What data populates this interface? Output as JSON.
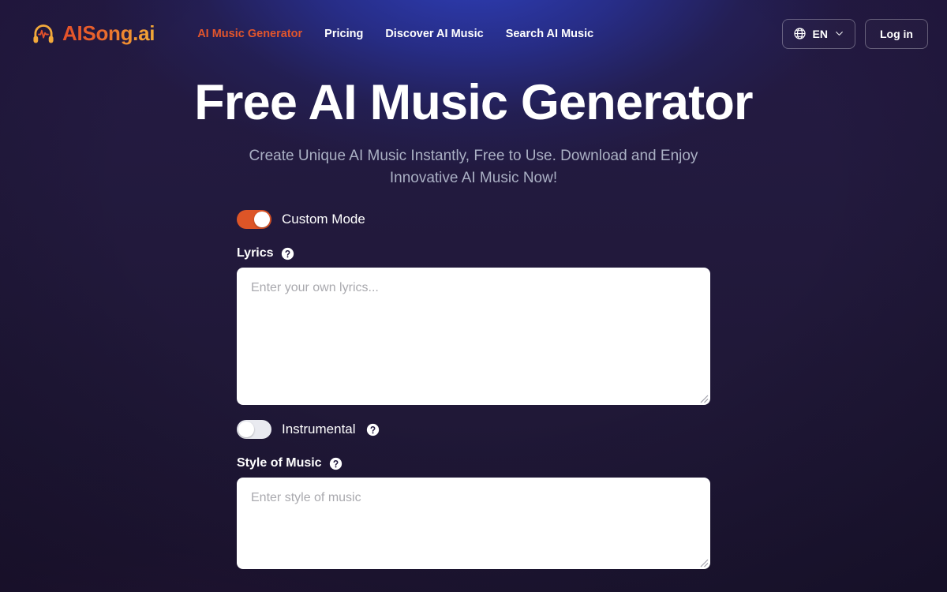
{
  "brand": {
    "name": "AISong.ai",
    "logo_icon": "headphones-waveform-icon",
    "gradient_start": "#e4512a",
    "gradient_end": "#f3aa37"
  },
  "header": {
    "nav": [
      {
        "label": "AI Music Generator",
        "active": true
      },
      {
        "label": "Pricing",
        "active": false
      },
      {
        "label": "Discover AI Music",
        "active": false
      },
      {
        "label": "Search AI Music",
        "active": false
      }
    ],
    "language": {
      "icon": "globe-icon",
      "value": "EN",
      "chevron": "chevron-down-icon"
    },
    "login_label": "Log in",
    "active_color": "#e2552c"
  },
  "hero": {
    "title": "Free AI Music Generator",
    "subtitle": "Create Unique AI Music Instantly, Free to Use. Download and Enjoy Innovative AI Music Now!"
  },
  "form": {
    "custom_mode": {
      "label": "Custom Mode",
      "state": "on",
      "on_color": "#dd5527"
    },
    "lyrics": {
      "label": "Lyrics",
      "help_icon": "help-circle-icon",
      "placeholder": "Enter your own lyrics...",
      "value": ""
    },
    "instrumental": {
      "label": "Instrumental",
      "state": "off",
      "help_icon": "help-circle-icon",
      "off_color": "#e9eaf0"
    },
    "style_of_music": {
      "label": "Style of Music",
      "help_icon": "help-circle-icon",
      "placeholder": "Enter style of music",
      "value": ""
    }
  }
}
